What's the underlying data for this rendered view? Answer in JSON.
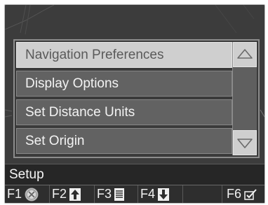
{
  "menu": {
    "items": [
      {
        "label": "Navigation Preferences",
        "selected": true
      },
      {
        "label": "Display Options",
        "selected": false
      },
      {
        "label": "Set Distance Units",
        "selected": false
      },
      {
        "label": "Set Origin",
        "selected": false
      }
    ],
    "scroll_up_icon": "triangle-up-outline",
    "scroll_down_icon": "triangle-down-outline"
  },
  "title_bar": {
    "label": "Setup"
  },
  "fkeys": [
    {
      "key": "F1",
      "icon": "cancel-circle-x"
    },
    {
      "key": "F2",
      "icon": "arrow-up"
    },
    {
      "key": "F3",
      "icon": "list-lines"
    },
    {
      "key": "F4",
      "icon": "arrow-down"
    },
    {
      "key": "F6",
      "icon": "checkbox-check"
    }
  ],
  "colors": {
    "screen_bg": "#3c3c3c",
    "menu_item_bg": "#626262",
    "selected_bg": "#cfcfcf",
    "text": "#f3f3f3"
  }
}
